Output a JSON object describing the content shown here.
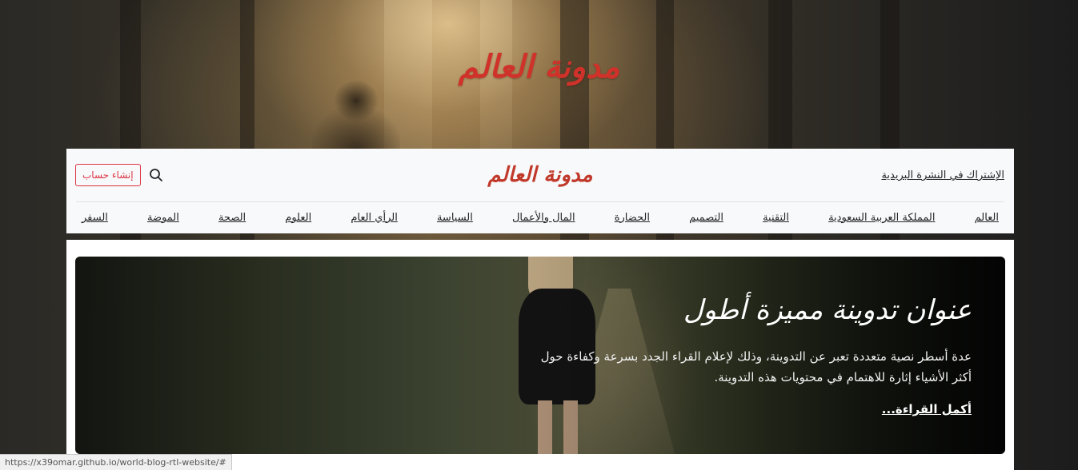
{
  "hero": {
    "logo_text": "مدونة العالم"
  },
  "header": {
    "subscribe_label": "الإشتراك في النشرة البريدية",
    "logo_text": "مدونة العالم",
    "signup_label": "إنشاء حساب",
    "search_icon": "search-icon"
  },
  "nav": {
    "items": [
      {
        "label": "العالم"
      },
      {
        "label": "المملكة العربية السعودية"
      },
      {
        "label": "التقنية"
      },
      {
        "label": "التصميم"
      },
      {
        "label": "الحضارة"
      },
      {
        "label": "المال والأعمال"
      },
      {
        "label": "السياسة"
      },
      {
        "label": "الرأي العام"
      },
      {
        "label": "العلوم"
      },
      {
        "label": "الصحة"
      },
      {
        "label": "الموضة"
      },
      {
        "label": "السفر"
      }
    ]
  },
  "feature": {
    "title": "عنوان تدوينة مميزة أطول",
    "lead": "عدة أسطر نصية متعددة تعبر عن التدوينة، وذلك لإعلام القراء الجدد بسرعة وكفاءة حول أكثر الأشياء إثارة للاهتمام في محتويات هذه التدوينة.",
    "link_label": "أكمل القراءة..."
  },
  "status_bar": {
    "url": "https://x39omar.github.io/world-blog-rtl-website/#"
  },
  "colors": {
    "brand_red": "#d0322a",
    "signup_red": "#dc3545"
  }
}
